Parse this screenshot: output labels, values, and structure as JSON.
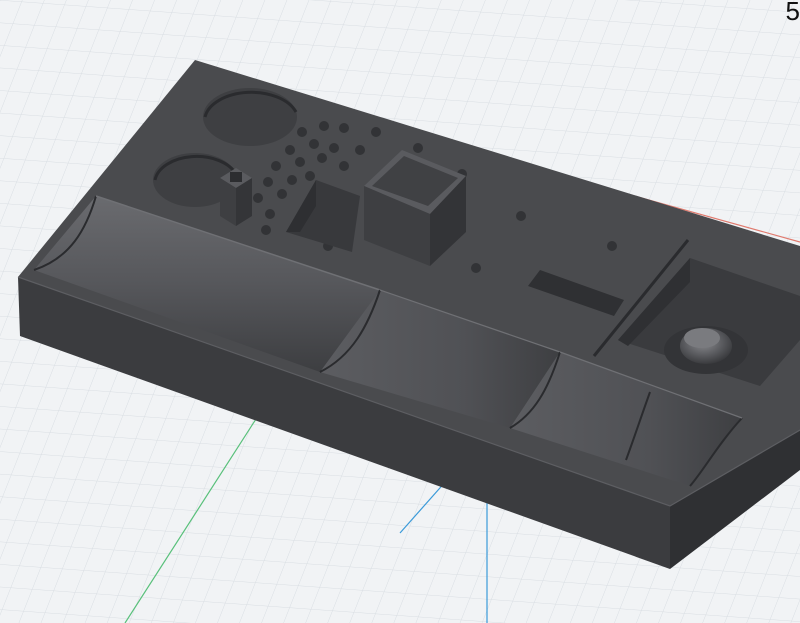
{
  "viewport": {
    "corner_label": "5",
    "background_color": "#f1f3f5",
    "grid_color": "#d8dde2"
  },
  "axes": {
    "x_color": "#e07a6e",
    "y_color": "#3a9ad9",
    "z_color": "#58c07a"
  },
  "model": {
    "name": "organizer-tray",
    "color": "#4a4b4e"
  }
}
